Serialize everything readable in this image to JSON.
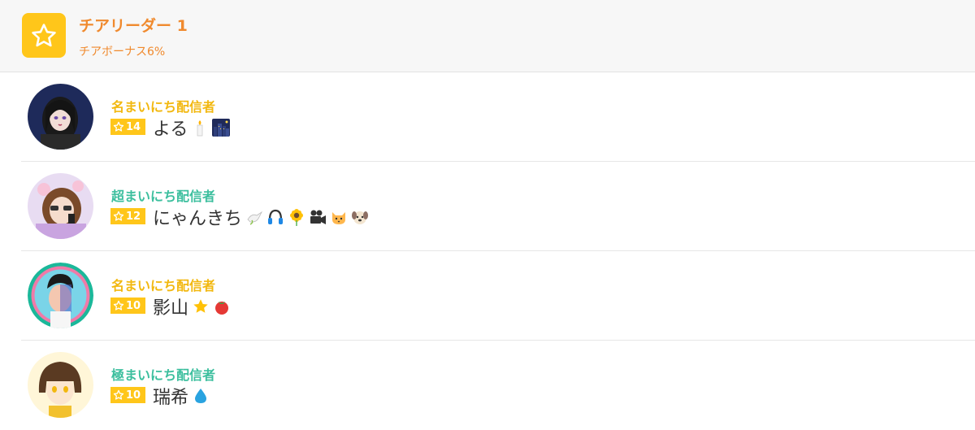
{
  "header": {
    "title": "チアリーダー 1",
    "subtitle": "チアボーナス6%",
    "icon": "star-icon",
    "accent_color": "#f08a2e",
    "icon_bg": "#ffc61a"
  },
  "users": [
    {
      "rank": "名まいにち配信者",
      "level": "14",
      "name": "よる",
      "emojis": [
        "candle-icon",
        "night-city-icon"
      ]
    },
    {
      "rank": "超まいにち配信者",
      "level": "12",
      "name": "にゃんきち",
      "emojis": [
        "dove-icon",
        "headphones-icon",
        "sunflower-icon",
        "movie-camera-icon",
        "cat-face-icon",
        "dog-face-icon"
      ]
    },
    {
      "rank": "名まいにち配信者",
      "level": "10",
      "name": "影山",
      "emojis": [
        "star-icon",
        "tomato-icon"
      ]
    },
    {
      "rank": "極まいにち配信者",
      "level": "10",
      "name": "瑞希",
      "emojis": [
        "droplet-icon"
      ]
    }
  ],
  "colors": {
    "rank_gold": "#f2b810",
    "rank_teal": "#3cbf9e",
    "badge": "#ffc61a"
  }
}
